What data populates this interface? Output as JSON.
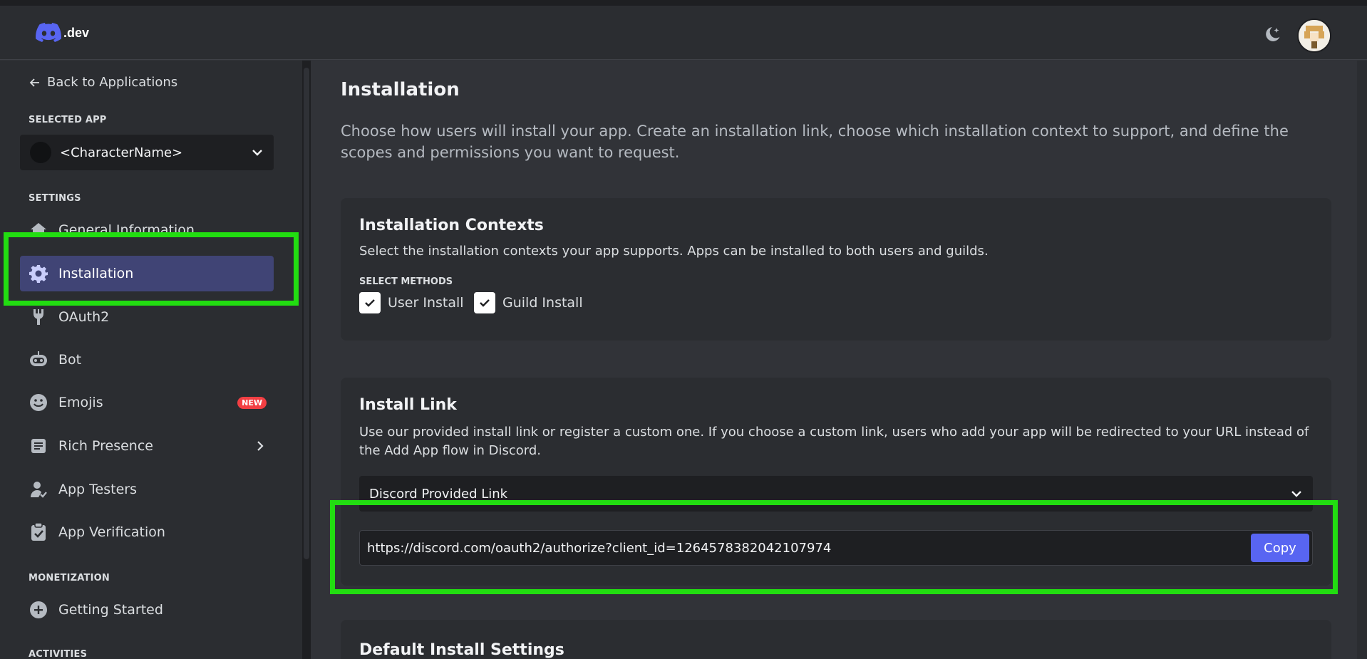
{
  "topbar": {
    "logo_text": ".dev",
    "theme_icon": "moon-sparkle-icon",
    "avatar_icon": "user-avatar"
  },
  "sidebar": {
    "back_label": "Back to Applications",
    "selected_app_heading": "SELECTED APP",
    "selected_app_name": "<CharacterName>",
    "settings_heading": "SETTINGS",
    "items": [
      {
        "label": "General Information",
        "icon": "home-icon"
      },
      {
        "label": "Installation",
        "icon": "gear-icon",
        "active": true
      },
      {
        "label": "OAuth2",
        "icon": "wrench-icon"
      },
      {
        "label": "Bot",
        "icon": "bot-icon"
      },
      {
        "label": "Emojis",
        "icon": "emoji-icon",
        "badge": "NEW"
      },
      {
        "label": "Rich Presence",
        "icon": "document-icon"
      },
      {
        "label": "App Testers",
        "icon": "person-icon"
      },
      {
        "label": "App Verification",
        "icon": "clipboard-check-icon"
      }
    ],
    "monetization_heading": "MONETIZATION",
    "monetization_items": [
      {
        "label": "Getting Started",
        "icon": "plus-circle-icon"
      }
    ],
    "activities_heading": "ACTIVITIES"
  },
  "main": {
    "title": "Installation",
    "description": "Choose how users will install your app. Create an installation link, choose which installation context to support, and define the scopes and permissions you want to request.",
    "contexts": {
      "title": "Installation Contexts",
      "description": "Select the installation contexts your app supports. Apps can be installed to both users and guilds.",
      "methods_heading": "SELECT METHODS",
      "user_install_label": "User Install",
      "user_install_checked": true,
      "guild_install_label": "Guild Install",
      "guild_install_checked": true
    },
    "install_link": {
      "title": "Install Link",
      "description": "Use our provided install link or register a custom one. If you choose a custom link, users who add your app will be redirected to your URL instead of the Add App flow in Discord.",
      "dropdown_value": "Discord Provided Link",
      "link": "https://discord.com/oauth2/authorize?client_id=1264578382042107974",
      "copy_label": "Copy"
    },
    "default_settings": {
      "title": "Default Install Settings"
    }
  },
  "colors": {
    "accent": "#5865f2",
    "active_nav": "#404475",
    "highlight": "#22dd11",
    "badge": "#f23f43"
  }
}
